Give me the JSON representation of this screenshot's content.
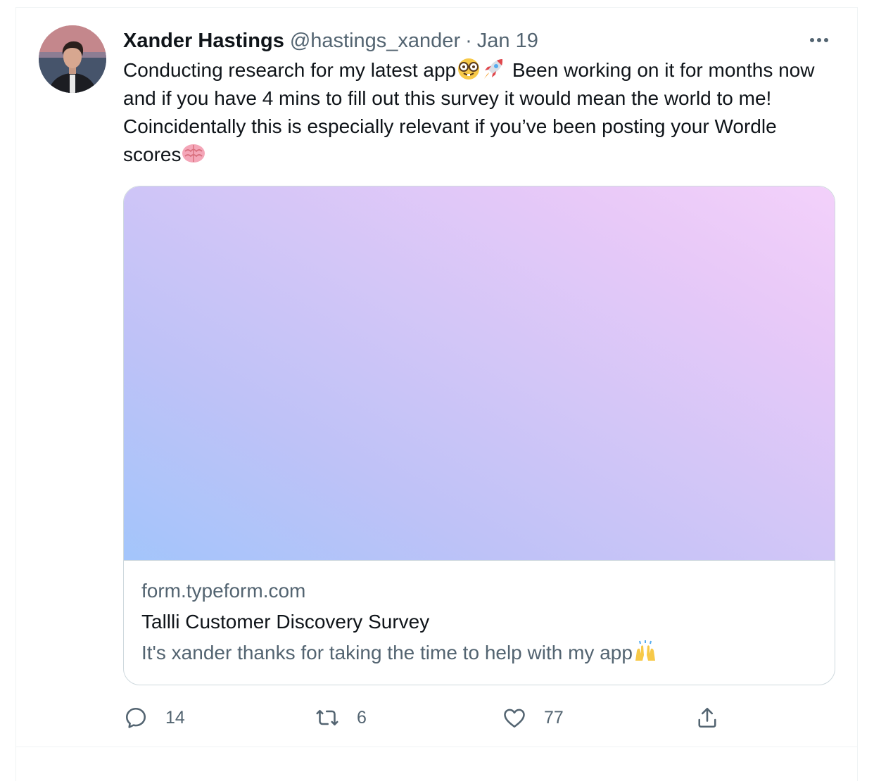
{
  "author": {
    "name": "Xander Hastings",
    "handle": "@hastings_xander",
    "separator": "·",
    "date": "Jan 19"
  },
  "tweet": {
    "text_part1": "Conducting research for my latest app",
    "text_part2": " Been working on it for months now and if you have 4 mins to fill out this survey it would mean the world to me! Coincidentally this is especially relevant if you’ve been posting your Wordle scores",
    "emojis": [
      "nerd-face-emoji",
      "rocket-emoji",
      "brain-emoji"
    ]
  },
  "card": {
    "domain": "form.typeform.com",
    "title": "Tallli Customer Discovery Survey",
    "description": "It's xander thanks for taking the time to help with my app",
    "description_emoji": "raising-hands-emoji",
    "gradient_colors": [
      "#a3c5fb",
      "#d4c6f7",
      "#f3d1fa"
    ]
  },
  "actions": {
    "reply_count": "14",
    "retweet_count": "6",
    "like_count": "77"
  },
  "colors": {
    "text_primary": "#0f1419",
    "text_secondary": "#536471",
    "border": "#cfd9de"
  }
}
